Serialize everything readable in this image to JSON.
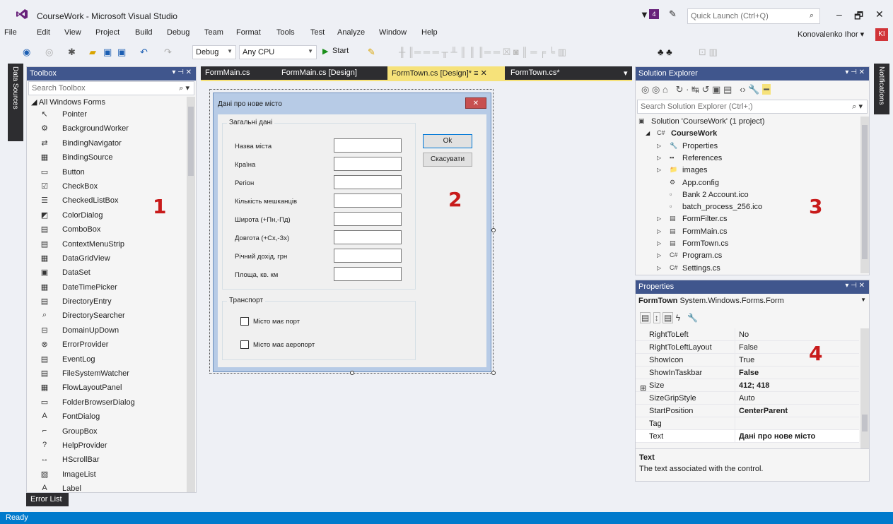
{
  "window": {
    "title": "CourseWork - Microsoft Visual Studio",
    "notif_count": "4",
    "quick_launch": "Quick Launch (Ctrl+Q)",
    "minimize": "–",
    "restore": "🗗",
    "close": "✕"
  },
  "menu": {
    "items": [
      "File",
      "Edit",
      "View",
      "Project",
      "Build",
      "Debug",
      "Team",
      "Format",
      "Tools",
      "Test",
      "Analyze",
      "Window",
      "Help"
    ],
    "user": "Konovalenko Ihor ▾",
    "avatar": "KI"
  },
  "toolbar": {
    "config": "Debug",
    "platform": "Any CPU",
    "start": "Start"
  },
  "left_tab": "Data Sources",
  "right_tab": "Notifications",
  "toolbox": {
    "title": "Toolbox",
    "search": "Search Toolbox",
    "group": "◢ All Windows Forms",
    "items": [
      {
        "label": "Pointer",
        "icon": "↖"
      },
      {
        "label": "BackgroundWorker",
        "icon": "⚙"
      },
      {
        "label": "BindingNavigator",
        "icon": "⇄"
      },
      {
        "label": "BindingSource",
        "icon": "▦"
      },
      {
        "label": "Button",
        "icon": "▭"
      },
      {
        "label": "CheckBox",
        "icon": "☑"
      },
      {
        "label": "CheckedListBox",
        "icon": "☰"
      },
      {
        "label": "ColorDialog",
        "icon": "◩"
      },
      {
        "label": "ComboBox",
        "icon": "▤"
      },
      {
        "label": "ContextMenuStrip",
        "icon": "▤"
      },
      {
        "label": "DataGridView",
        "icon": "▦"
      },
      {
        "label": "DataSet",
        "icon": "▣"
      },
      {
        "label": "DateTimePicker",
        "icon": "▦"
      },
      {
        "label": "DirectoryEntry",
        "icon": "▤"
      },
      {
        "label": "DirectorySearcher",
        "icon": "⌕"
      },
      {
        "label": "DomainUpDown",
        "icon": "⊟"
      },
      {
        "label": "ErrorProvider",
        "icon": "⊗"
      },
      {
        "label": "EventLog",
        "icon": "▤"
      },
      {
        "label": "FileSystemWatcher",
        "icon": "▤"
      },
      {
        "label": "FlowLayoutPanel",
        "icon": "▦"
      },
      {
        "label": "FolderBrowserDialog",
        "icon": "▭"
      },
      {
        "label": "FontDialog",
        "icon": "A"
      },
      {
        "label": "GroupBox",
        "icon": "⌐"
      },
      {
        "label": "HelpProvider",
        "icon": "?"
      },
      {
        "label": "HScrollBar",
        "icon": "↔"
      },
      {
        "label": "ImageList",
        "icon": "▨"
      },
      {
        "label": "Label",
        "icon": "A"
      }
    ]
  },
  "designer": {
    "tabs": [
      "FormMain.cs",
      "FormMain.cs [Design]",
      "FormTown.cs [Design]*",
      "FormTown.cs*"
    ],
    "form": {
      "caption": "Дані про нове місто",
      "group_general": "Загальні дані",
      "labels": [
        "Назва міста",
        "Країна",
        "Регіон",
        "Кількість мешканців",
        "Широта (+Пн,-Пд)",
        "Довгота (+Сх,-Зх)",
        "Річний дохід, грн",
        "Площа, кв. км"
      ],
      "ok": "Ok",
      "cancel": "Скасувати",
      "group_transport": "Транспорт",
      "chk_port": "Місто має порт",
      "chk_airport": "Місто має аеропорт"
    }
  },
  "solution_explorer": {
    "title": "Solution Explorer",
    "search": "Search Solution Explorer (Ctrl+;)",
    "rows": [
      {
        "label": "Solution 'CourseWork' (1 project)",
        "indent": 0,
        "bold": false,
        "icon": "▣",
        "arrow": ""
      },
      {
        "label": "CourseWork",
        "indent": 1,
        "bold": true,
        "icon": "C#",
        "arrow": "◢"
      },
      {
        "label": "Properties",
        "indent": 2,
        "bold": false,
        "icon": "🔧",
        "arrow": "▷"
      },
      {
        "label": "References",
        "indent": 2,
        "bold": false,
        "icon": "▪▪",
        "arrow": "▷"
      },
      {
        "label": "images",
        "indent": 2,
        "bold": false,
        "icon": "📁",
        "arrow": "▷"
      },
      {
        "label": "App.config",
        "indent": 2,
        "bold": false,
        "icon": "⚙",
        "arrow": ""
      },
      {
        "label": "Bank 2 Account.ico",
        "indent": 2,
        "bold": false,
        "icon": "▫",
        "arrow": ""
      },
      {
        "label": "batch_process_256.ico",
        "indent": 2,
        "bold": false,
        "icon": "▫",
        "arrow": ""
      },
      {
        "label": "FormFilter.cs",
        "indent": 2,
        "bold": false,
        "icon": "▤",
        "arrow": "▷"
      },
      {
        "label": "FormMain.cs",
        "indent": 2,
        "bold": false,
        "icon": "▤",
        "arrow": "▷"
      },
      {
        "label": "FormTown.cs",
        "indent": 2,
        "bold": false,
        "icon": "▤",
        "arrow": "▷"
      },
      {
        "label": "Program.cs",
        "indent": 2,
        "bold": false,
        "icon": "C#",
        "arrow": "▷"
      },
      {
        "label": "Settings.cs",
        "indent": 2,
        "bold": false,
        "icon": "C#",
        "arrow": "▷"
      }
    ]
  },
  "properties": {
    "title": "Properties",
    "object": "FormTown",
    "object_type": "System.Windows.Forms.Form",
    "rows": [
      {
        "name": "RightToLeft",
        "value": "No",
        "bold": false
      },
      {
        "name": "RightToLeftLayout",
        "value": "False",
        "bold": false
      },
      {
        "name": "ShowIcon",
        "value": "True",
        "bold": false
      },
      {
        "name": "ShowInTaskbar",
        "value": "False",
        "bold": true
      },
      {
        "name": "Size",
        "value": "412; 418",
        "bold": true
      },
      {
        "name": "SizeGripStyle",
        "value": "Auto",
        "bold": false
      },
      {
        "name": "StartPosition",
        "value": "CenterParent",
        "bold": true
      },
      {
        "name": "Tag",
        "value": "",
        "bold": false
      },
      {
        "name": "Text",
        "value": "Дані про нове місто",
        "bold": true
      }
    ],
    "desc_title": "Text",
    "desc_text": "The text associated with the control."
  },
  "annotations": [
    "1",
    "2",
    "3",
    "4"
  ],
  "bottom": {
    "error_list": "Error List",
    "status": "Ready"
  }
}
